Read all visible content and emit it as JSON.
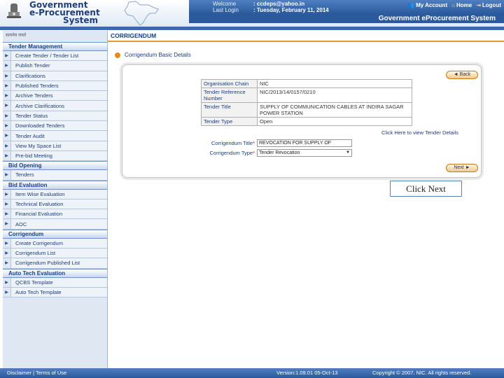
{
  "header": {
    "title_lines": [
      "Government",
      "e-Procurement",
      "System"
    ],
    "welcome_label": "Welcome",
    "welcome_value": ": ccdeps@yahoo.in",
    "last_login_label": "Last Login",
    "last_login_value": ": Tuesday, February 11, 2014",
    "links": {
      "account": "My Account",
      "home": "Home",
      "logout": "Logout"
    },
    "system_name": "Government eProcurement System",
    "emblem_caption": "सत्यमेव जयते"
  },
  "sidebar": {
    "sections": [
      {
        "title": "Tender Management",
        "items": [
          "Create Tender / Tender List",
          "Publish Tender",
          "Clarifications",
          "Published Tenders",
          "Archive Tenders",
          "Archive Clarifications",
          "Tender Status",
          "Downloaded Tenders",
          "Tender Audit",
          "View My Space List",
          "Pre-bid Meeting"
        ]
      },
      {
        "title": "Bid Opening",
        "items": [
          "Tenders"
        ]
      },
      {
        "title": "Bid Evaluation",
        "items": [
          "Item Wise Evaluation",
          "Technical Evaluation",
          "Financial Evaluation",
          "AOC"
        ]
      },
      {
        "title": "Corrigendum",
        "items": [
          "Create Corrigendum",
          "Corrigendum List",
          "Corrigendum Published List"
        ]
      },
      {
        "title": "Auto Tech Evaluation",
        "items": [
          "QCBS Template",
          "Auto Tech Template"
        ]
      }
    ]
  },
  "main": {
    "page_title": "CORRIGENDUM",
    "section_title": "Corrigendum Basic Details",
    "back_button": "◄ Back",
    "next_button": "Next ►",
    "info": [
      {
        "key": "Organisation Chain",
        "value": "NIC"
      },
      {
        "key": "Tender Reference Number",
        "value": "NIC/2013/14/0157/0210"
      },
      {
        "key": "Tender Title",
        "value": "SUPPLY OF COMMUNICATION CABLES AT INDIRA SAGAR POWER STATION"
      },
      {
        "key": "Tender Type",
        "value": "Open"
      }
    ],
    "view_link": "Click Here to view Tender Details",
    "corrigendum_title_label": "Corrigendum Title",
    "corrigendum_title_value": "REVOCATION FOR SUPPLY OF COMMUN",
    "corrigendum_type_label": "Corrigendum Type",
    "corrigendum_type_value": "Tender Revocation",
    "callout": "Click Next"
  },
  "footer": {
    "left": "Disclaimer  |  Terms of Use",
    "version": "Version:1.09.01 05-Oct-13",
    "copyright": "Copyright © 2007. NIC. All rights reserved."
  }
}
